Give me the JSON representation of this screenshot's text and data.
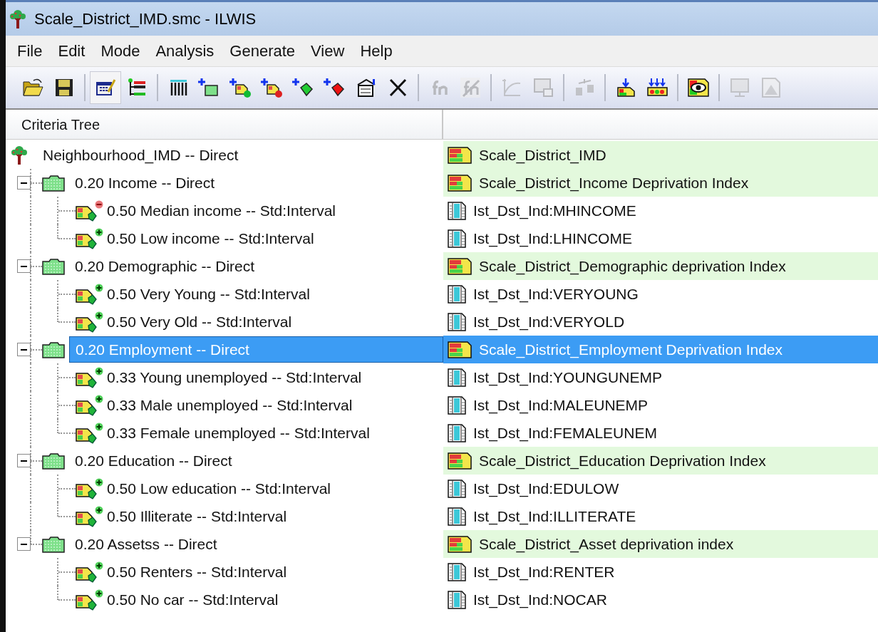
{
  "window": {
    "title": "Scale_District_IMD.smc - ILWIS"
  },
  "menu": [
    "File",
    "Edit",
    "Mode",
    "Analysis",
    "Generate",
    "View",
    "Help"
  ],
  "toolbar": [
    [
      {
        "kind": "open",
        "disabled": false,
        "pressed": false
      },
      {
        "kind": "save",
        "disabled": false,
        "pressed": false
      }
    ],
    [
      {
        "kind": "edit",
        "disabled": false,
        "pressed": true
      },
      {
        "kind": "tree",
        "disabled": false,
        "pressed": false
      }
    ],
    [
      {
        "kind": "columns",
        "disabled": false,
        "pressed": false
      },
      {
        "kind": "add-group",
        "disabled": false,
        "pressed": false
      },
      {
        "kind": "add-benefit",
        "disabled": false,
        "pressed": false
      },
      {
        "kind": "add-cost",
        "disabled": false,
        "pressed": false
      },
      {
        "kind": "add-green",
        "disabled": false,
        "pressed": false
      },
      {
        "kind": "add-red",
        "disabled": false,
        "pressed": false
      },
      {
        "kind": "properties",
        "disabled": false,
        "pressed": false
      },
      {
        "kind": "delete",
        "disabled": false,
        "pressed": false
      }
    ],
    [
      {
        "kind": "fn",
        "disabled": true,
        "pressed": false
      },
      {
        "kind": "fn-edit",
        "disabled": true,
        "pressed": false
      }
    ],
    [
      {
        "kind": "graph",
        "disabled": true,
        "pressed": false
      },
      {
        "kind": "map-window",
        "disabled": true,
        "pressed": false
      }
    ],
    [
      {
        "kind": "weights",
        "disabled": true,
        "pressed": false
      }
    ],
    [
      {
        "kind": "generate-one",
        "disabled": false,
        "pressed": false
      },
      {
        "kind": "generate-all",
        "disabled": false,
        "pressed": false
      }
    ],
    [
      {
        "kind": "show",
        "disabled": false,
        "pressed": false
      }
    ],
    [
      {
        "kind": "display",
        "disabled": true,
        "pressed": false
      },
      {
        "kind": "histogram",
        "disabled": true,
        "pressed": false
      }
    ]
  ],
  "tree": {
    "column": "Criteria Tree",
    "root": {
      "label": "Neighbourhood_IMD -- Direct",
      "map": "Scale_District_IMD",
      "selected": false,
      "children": [
        {
          "label": "0.20 Income -- Direct",
          "map": "Scale_District_Income Deprivation Index",
          "expanded": true,
          "selected": false,
          "children": [
            {
              "label": "0.50 Median income -- Std:Interval",
              "map": "Ist_Dst_Ind:MHINCOME",
              "kind": "cost",
              "selected": false
            },
            {
              "label": "0.50 Low income -- Std:Interval",
              "map": "Ist_Dst_Ind:LHINCOME",
              "kind": "benefit",
              "selected": false
            }
          ]
        },
        {
          "label": "0.20 Demographic -- Direct",
          "map": "Scale_District_Demographic deprivation Index",
          "expanded": true,
          "selected": false,
          "children": [
            {
              "label": "0.50 Very Young -- Std:Interval",
              "map": "Ist_Dst_Ind:VERYOUNG",
              "kind": "benefit",
              "selected": false
            },
            {
              "label": "0.50 Very Old -- Std:Interval",
              "map": "Ist_Dst_Ind:VERYOLD",
              "kind": "benefit",
              "selected": false
            }
          ]
        },
        {
          "label": "0.20 Employment -- Direct",
          "map": "Scale_District_Employment Deprivation Index",
          "expanded": true,
          "selected": true,
          "children": [
            {
              "label": "0.33 Young unemployed -- Std:Interval",
              "map": "Ist_Dst_Ind:YOUNGUNEMP",
              "kind": "benefit",
              "selected": false
            },
            {
              "label": "0.33 Male unemployed -- Std:Interval",
              "map": "Ist_Dst_Ind:MALEUNEMP",
              "kind": "benefit",
              "selected": false
            },
            {
              "label": "0.33 Female unemployed -- Std:Interval",
              "map": "Ist_Dst_Ind:FEMALEUNEM",
              "kind": "benefit",
              "selected": false
            }
          ]
        },
        {
          "label": "0.20 Education -- Direct",
          "map": "Scale_District_Education Deprivation Index",
          "expanded": true,
          "selected": false,
          "children": [
            {
              "label": "0.50 Low education -- Std:Interval",
              "map": "Ist_Dst_Ind:EDULOW",
              "kind": "benefit",
              "selected": false
            },
            {
              "label": "0.50 Illiterate -- Std:Interval",
              "map": "Ist_Dst_Ind:ILLITERATE",
              "kind": "benefit",
              "selected": false
            }
          ]
        },
        {
          "label": "0.20 Assetss -- Direct",
          "map": "Scale_District_Asset deprivation index",
          "expanded": true,
          "selected": false,
          "children": [
            {
              "label": "0.50 Renters -- Std:Interval",
              "map": "Ist_Dst_Ind:RENTER",
              "kind": "benefit",
              "selected": false
            },
            {
              "label": "0.50 No car -- Std:Interval",
              "map": "Ist_Dst_Ind:NOCAR",
              "kind": "benefit",
              "selected": false
            }
          ]
        }
      ]
    }
  }
}
